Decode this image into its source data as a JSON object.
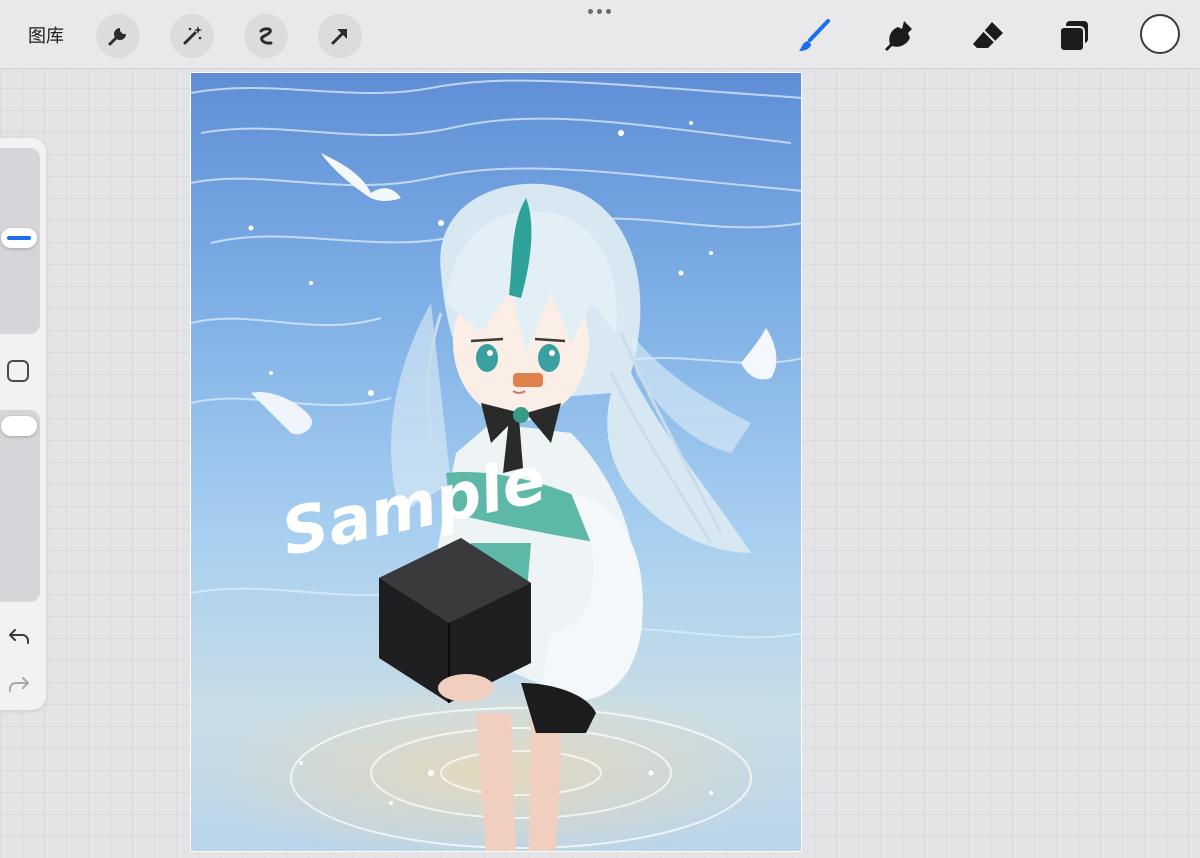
{
  "toolbar": {
    "gallery_label": "图库",
    "left_tools": [
      "wrench-icon",
      "magic-wand-icon",
      "selection-icon",
      "transform-arrow-icon"
    ],
    "right_tools": [
      "brush-icon",
      "smudge-icon",
      "eraser-icon",
      "layers-icon"
    ],
    "active_tool": "brush-icon",
    "accent_color": "#1a6ff0",
    "current_color": "#ffffff"
  },
  "sidebar": {
    "controls": [
      "brush-size-slider",
      "modify-button",
      "opacity-slider",
      "undo-button",
      "redo-button"
    ]
  },
  "canvas": {
    "watermark_text": "Sample"
  }
}
